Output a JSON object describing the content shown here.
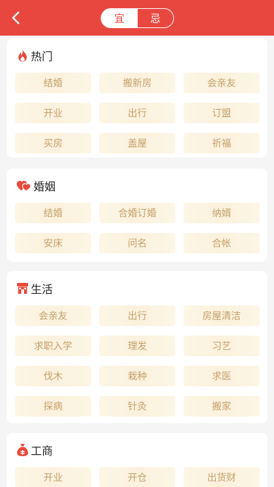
{
  "colors": {
    "primary": "#e8473f",
    "chip_bg": "#fbf1dd",
    "chip_text": "#c5a06a",
    "icon_red": "#e84a3c"
  },
  "header": {
    "back_icon": "chevron-left-icon",
    "tabs": [
      {
        "label": "宜",
        "active": true
      },
      {
        "label": "忌",
        "active": false
      }
    ]
  },
  "sections": [
    {
      "title": "热门",
      "icon": "flame-icon",
      "items": [
        "结婚",
        "搬新房",
        "会亲友",
        "开业",
        "出行",
        "订盟",
        "买房",
        "盖屋",
        "祈福"
      ]
    },
    {
      "title": "婚姻",
      "icon": "hearts-icon",
      "items": [
        "结婚",
        "合婚订婚",
        "纳婿",
        "安床",
        "问名",
        "合帐"
      ]
    },
    {
      "title": "生活",
      "icon": "house-icon",
      "items": [
        "会亲友",
        "出行",
        "房屋清洁",
        "求职入学",
        "理发",
        "习艺",
        "伐木",
        "栽种",
        "求医",
        "探病",
        "针灸",
        "搬家"
      ]
    },
    {
      "title": "工商",
      "icon": "money-bag-icon",
      "items": [
        "开业",
        "开仓",
        "出货财"
      ]
    }
  ]
}
